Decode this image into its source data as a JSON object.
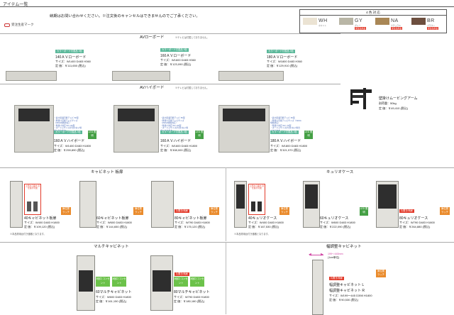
{
  "header": {
    "title": "アイテム一覧"
  },
  "notice": "納期はお問い合わせください。※注文後のキャンセルはできませんのでご了承ください。",
  "legend_key": "受注生産マーク",
  "colors": {
    "heading": "4 色 対 応",
    "swatches": [
      {
        "code": "WH",
        "sub": "ホワイト",
        "tag": "",
        "color": "#ebe3d3"
      },
      {
        "code": "GY",
        "sub": "グレー",
        "tag": "受注生産品",
        "color": "#b9b6a6"
      },
      {
        "code": "NA",
        "sub": "ナチュラル",
        "tag": "受注生産品",
        "color": "#a98756"
      },
      {
        "code": "BR",
        "sub": "ブラウン",
        "tag": "受注生産品",
        "color": "#6d4f3f"
      }
    ]
  },
  "av_low": {
    "title": "AVローボード",
    "note": "※テレビは付属しておりません。",
    "items": [
      {
        "badge": "カラーボード付属品 3色",
        "name": "140ＡＶローボード",
        "size": "サイズ：W1400 D483 H360",
        "price": "定 価：￥111,650 (税込)"
      },
      {
        "badge": "カラーボード付属品 3色",
        "name": "160ＡＶローボード",
        "size": "サイズ：W1600 D483 H360",
        "price": "定 価：￥123,090 (税込)"
      },
      {
        "badge": "カラーボード付属品 3色",
        "name": "180ＡＶローボード",
        "size": "サイズ：W1800 D483 H360",
        "price": "定 価：￥129,910 (税込)"
      }
    ]
  },
  "av_high": {
    "title": "AVハイボード",
    "note": "※テレビは付属しておりません。",
    "items": [
      {
        "badge": "カラーボード付属品 3色",
        "name": "160ＡＶハイボード",
        "size": "サイズ：W1400 D483 H1800",
        "price": "定 価：￥259,890 (税込)",
        "led": "LED 照明",
        "notes": [
          "・最大搭載可能テレビ 50型",
          "・壁掛け可能テレビサイズ（VESA規格対応）",
          "・壁掛け対応 50〜60型",
          "・ボードとサイズが合わない場合もあります。"
        ]
      },
      {
        "badge": "カラーボード付属品 3色",
        "name": "160ＡＶハイボード",
        "size": "サイズ：W1600 D483 H1800",
        "price": "定 価：￥308,000 (税込)",
        "led": "LED 照明",
        "notes": [
          "・最大搭載可能テレビ 55型",
          "・壁掛け可能テレビサイズ（VESA規格対応）",
          "・壁掛け対応 50〜65型",
          "・ボードとサイズが合わない場合もあります。"
        ]
      },
      {
        "badge": "カラーボード付属品 3色",
        "name": "180ＡＶハイボード",
        "size": "サイズ：W1800 D483 H1800",
        "price": "定 価：￥321,970 (税込)",
        "led": "LED 照明",
        "notes": [
          "・最大搭載可能テレビ 65型",
          "・壁掛け可能テレビサイズ（VESA規格対応）",
          "・壁掛け対応 50〜75型",
          "・ボードとサイズが合わない場合もあります。"
        ]
      }
    ]
  },
  "wall_arm": {
    "name": "壁掛けムービングアーム",
    "load": "耐荷重：50kg",
    "price": "定 価：￥49,410 (税込)"
  },
  "cabinet": {
    "title": "キャビネット 板扉",
    "items": [
      {
        "callout": "上部から開き 扉を開け可能",
        "name": "40キャビネット板扉",
        "size": "サイズ：W400 D483 H1800",
        "price": "定 価：￥109,120 (税込)",
        "tag": "扉位置 ラッチ"
      },
      {
        "name": "60キャビネット板扉",
        "size": "サイズ：W600 D483 H1800",
        "price": "定 価：￥144,650 (税込)",
        "tag": "扉位置 ラッチ"
      },
      {
        "red": "片開き/両扉",
        "name": "80キャビネット板扉",
        "size": "サイズ：W790 D483 H1800",
        "price": "定 価：￥175,120 (税込)",
        "tag": "扉位置 ラッチ"
      }
    ],
    "footnote": "※本品専用台付き価格となります。"
  },
  "curio": {
    "title": "キュリオケース",
    "items": [
      {
        "callout": "上部から開き 扉を開け可能",
        "name": "40キュリオケース",
        "size": "サイズ：W400 D483 H1800",
        "price": "定 価：￥167,530 (税込)",
        "tag": "扉位置 ラッチ"
      },
      {
        "name": "60キュリオケース",
        "size": "サイズ：W600 D483 H1800",
        "price": "定 価：￥222,090 (税込)",
        "led": "LED 照明"
      },
      {
        "red": "片開き/両扉",
        "name": "80キュリオケース",
        "size": "サイズ：W790 D483 H1800",
        "price": "定 価：￥264,880 (税込)",
        "tag": "扉位置 ラッチ"
      }
    ],
    "footnote": "※本品専用台付き価格となります。"
  },
  "multi": {
    "title": "マルチキャビネット",
    "items": [
      {
        "g1": "3個口 コンセント",
        "g2": "3個口 コンセント",
        "name": "60マルチキャビネット",
        "size": "サイズ：W600 D483 H1800",
        "price": "定 価：￥161,150 (税込)"
      },
      {
        "red": "片開き/両扉",
        "g1": "3個口 コンセント",
        "g2": "3個口 コンセント",
        "name": "80マルチキャビネット",
        "size": "サイズ：W790 D483 H1800",
        "price": "定 価：￥180,180 (税込)"
      }
    ]
  },
  "adjust": {
    "title": "幅調整キャビネット",
    "range": "199〜445mm",
    "step": "(1cm単位)",
    "red": "片開き/両扉",
    "name_l": "幅調整キャビネット L",
    "name_r": "幅調整キャビネット R",
    "size": "サイズ：W199〜445 D398 H1800",
    "price": "定 価：￥90,530 (税込)",
    "tag": "扉位置 ラッチ"
  }
}
